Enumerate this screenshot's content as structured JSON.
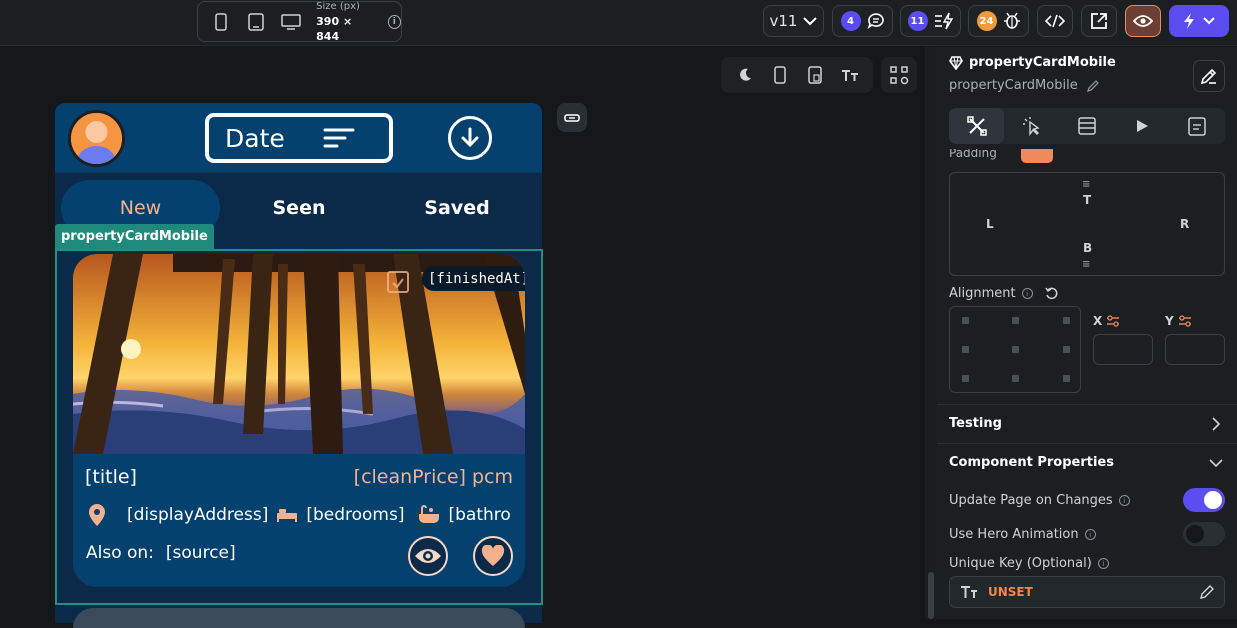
{
  "topbar": {
    "size_label": "Size (px)",
    "size_value": "390 × 844",
    "version": "v11",
    "comments_count": "4",
    "actions_count": "11",
    "issues_count": "24"
  },
  "phone": {
    "date_label": "Date",
    "tabs": [
      {
        "label": "New",
        "active": true
      },
      {
        "label": "Seen",
        "active": false
      },
      {
        "label": "Saved",
        "active": false
      }
    ],
    "component_label": "propertyCardMobile",
    "card": {
      "finished": "[finishedAt]",
      "title": "[title]",
      "price": "[cleanPrice] pcm",
      "address": "[displayAddress]",
      "bedrooms": "[bedrooms]",
      "bathrooms": "[bathro",
      "also_on_label": "Also on:",
      "source": "[source]"
    }
  },
  "panel": {
    "title": "propertyCardMobile",
    "subtitle": "propertyCardMobile",
    "padding_label": "Padding",
    "pad_top": "T",
    "pad_left": "L",
    "pad_right": "R",
    "pad_bottom": "B",
    "alignment_label": "Alignment",
    "x_label": "X",
    "y_label": "Y",
    "testing_label": "Testing",
    "component_properties_label": "Component Properties",
    "update_page_label": "Update Page on Changes",
    "update_page_on": true,
    "hero_animation_label": "Use Hero Animation",
    "hero_animation_on": false,
    "unique_key_label": "Unique Key (Optional)",
    "unset_label": "UNSET",
    "accent_color": "#5b4cf0"
  }
}
